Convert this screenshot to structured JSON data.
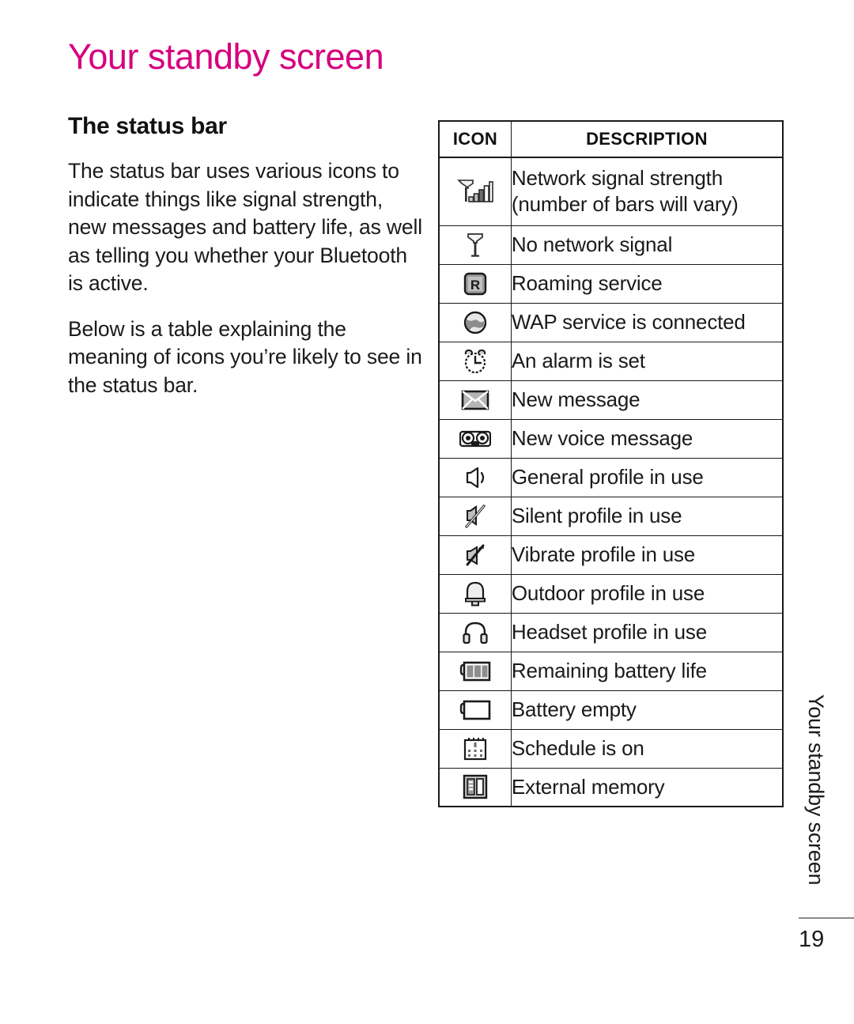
{
  "page": {
    "title": "Your standby screen",
    "section_title": "The status bar",
    "paragraphs": [
      "The status bar uses various icons to indicate things like signal strength, new messages and battery life, as well as telling you whether your Bluetooth is active.",
      "Below is a table explaining the meaning of icons you’re likely to see in the status bar."
    ],
    "side_tab_text": "Your standby screen",
    "page_number": "19",
    "colors": {
      "title_pink": "#D6007F",
      "text_black": "#1A1A1A",
      "rule_gray": "#8A8A8A",
      "icon_gray": "#B5B5B5"
    }
  },
  "table": {
    "headers": [
      "ICON",
      "DESCRIPTION"
    ],
    "rows": [
      {
        "icon": "signal-strength-icon",
        "description_lines": [
          "Network signal strength",
          "(number of bars will vary)"
        ]
      },
      {
        "icon": "no-signal-icon",
        "description_lines": [
          "No network signal"
        ]
      },
      {
        "icon": "roaming-icon",
        "description_lines": [
          "Roaming service"
        ]
      },
      {
        "icon": "wap-globe-icon",
        "description_lines": [
          "WAP service is connected"
        ]
      },
      {
        "icon": "alarm-clock-icon",
        "description_lines": [
          "An alarm is set"
        ]
      },
      {
        "icon": "envelope-icon",
        "description_lines": [
          "New message"
        ]
      },
      {
        "icon": "voice-message-icon",
        "description_lines": [
          "New voice message"
        ]
      },
      {
        "icon": "speaker-icon",
        "description_lines": [
          "General profile in use"
        ]
      },
      {
        "icon": "silent-icon",
        "description_lines": [
          "Silent profile in use"
        ]
      },
      {
        "icon": "vibrate-icon",
        "description_lines": [
          "Vibrate profile in use"
        ]
      },
      {
        "icon": "bell-icon",
        "description_lines": [
          "Outdoor profile in use"
        ]
      },
      {
        "icon": "headset-icon",
        "description_lines": [
          "Headset profile in use"
        ]
      },
      {
        "icon": "battery-full-icon",
        "description_lines": [
          "Remaining battery life"
        ]
      },
      {
        "icon": "battery-empty-icon",
        "description_lines": [
          "Battery empty"
        ]
      },
      {
        "icon": "calendar-icon",
        "description_lines": [
          "Schedule is on"
        ]
      },
      {
        "icon": "memory-card-icon",
        "description_lines": [
          "External memory"
        ]
      }
    ]
  }
}
